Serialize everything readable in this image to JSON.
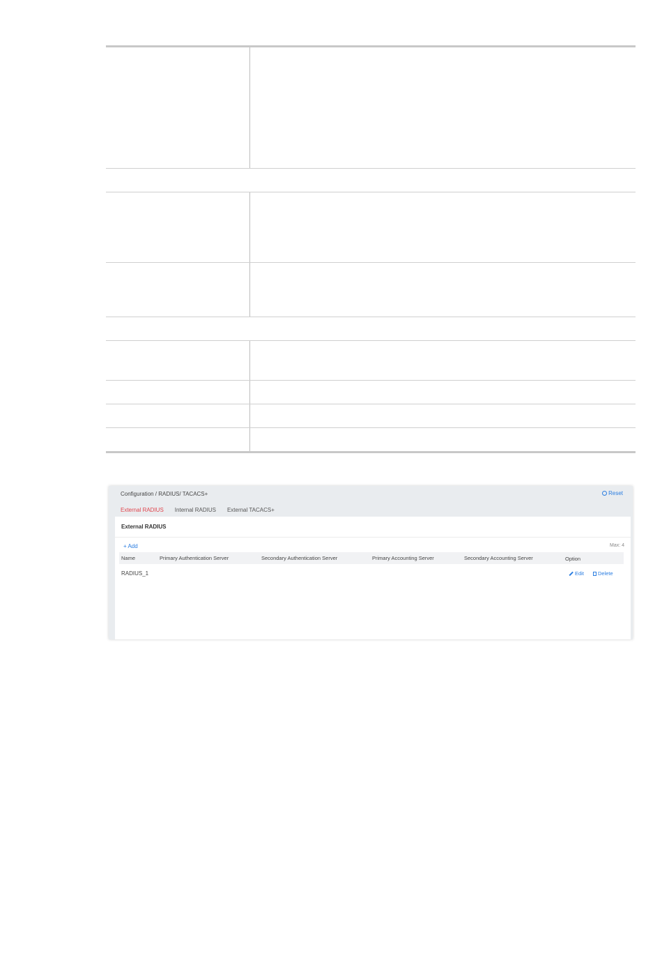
{
  "screenshot": {
    "breadcrumb": "Configuration / RADIUS/ TACACS+",
    "reset_label": "Reset",
    "tabs": [
      {
        "label": "External RADIUS",
        "active": true
      },
      {
        "label": "Internal RADIUS",
        "active": false
      },
      {
        "label": "External TACACS+",
        "active": false
      }
    ],
    "card_title": "External RADIUS",
    "add_label": "+ Add",
    "max_label": "Max: 4",
    "columns": [
      "Name",
      "Primary Authentication Server",
      "Secondary Authentication Server",
      "Primary Accounting Server",
      "Secondary Accounting Server",
      "Option"
    ],
    "rows": [
      {
        "name": "RADIUS_1",
        "edit_label": "Edit",
        "delete_label": "Delete"
      }
    ],
    "colors": {
      "accent": "#2a7de1",
      "active_tab": "#e0444c"
    }
  }
}
